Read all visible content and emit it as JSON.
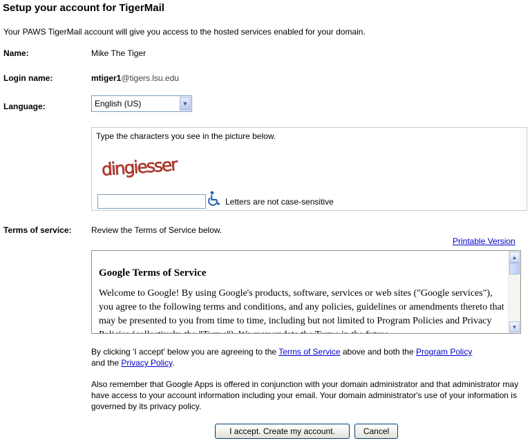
{
  "page": {
    "title": "Setup your account for TigerMail",
    "intro": "Your PAWS TigerMail account will give you access to the hosted services enabled for your domain."
  },
  "name": {
    "label": "Name:",
    "value": "Mike The Tiger"
  },
  "login": {
    "label": "Login name:",
    "username": "mtiger1",
    "domain": "@tigers.lsu.edu"
  },
  "language": {
    "label": "Language:",
    "selected": "English (US)"
  },
  "captcha": {
    "instruction": "Type the characters you see in the picture below.",
    "image_text": "dingiesser",
    "input_value": "",
    "case_note": "Letters are not case-sensitive",
    "accessibility_icon": "wheelchair-accessibility-icon"
  },
  "terms": {
    "label": "Terms of service:",
    "review_text": "Review the Terms of Service below.",
    "printable_link": "Printable Version",
    "heading": "Google Terms of Service",
    "body": "Welcome to Google! By using Google's products, software, services or web sites (\"Google services\"), you agree to the following terms and conditions, and any policies, guidelines or amendments thereto that may be presented to you from time to time, including but not limited to Program Policies and Privacy Policies (collectively, the \"Terms\"). We may update the Terms in the future."
  },
  "agreement": {
    "part1": "By clicking 'I accept' below you are agreeing to the ",
    "tos_link": "Terms of Service",
    "part2": " above and both the ",
    "program_link": "Program Policy",
    "part3": " and the ",
    "privacy_link": "Privacy Policy",
    "part4": "."
  },
  "notice": "Also remember that Google Apps is offered in conjunction with your domain administrator and that administrator may have access to your account information including your email. Your domain administrator's use of your information is governed by its privacy policy.",
  "buttons": {
    "accept": "I accept. Create my account.",
    "cancel": "Cancel"
  },
  "colors": {
    "link": "#0000cc",
    "captcha_text": "#c0392b",
    "accessibility_icon": "#1f5fb4"
  }
}
